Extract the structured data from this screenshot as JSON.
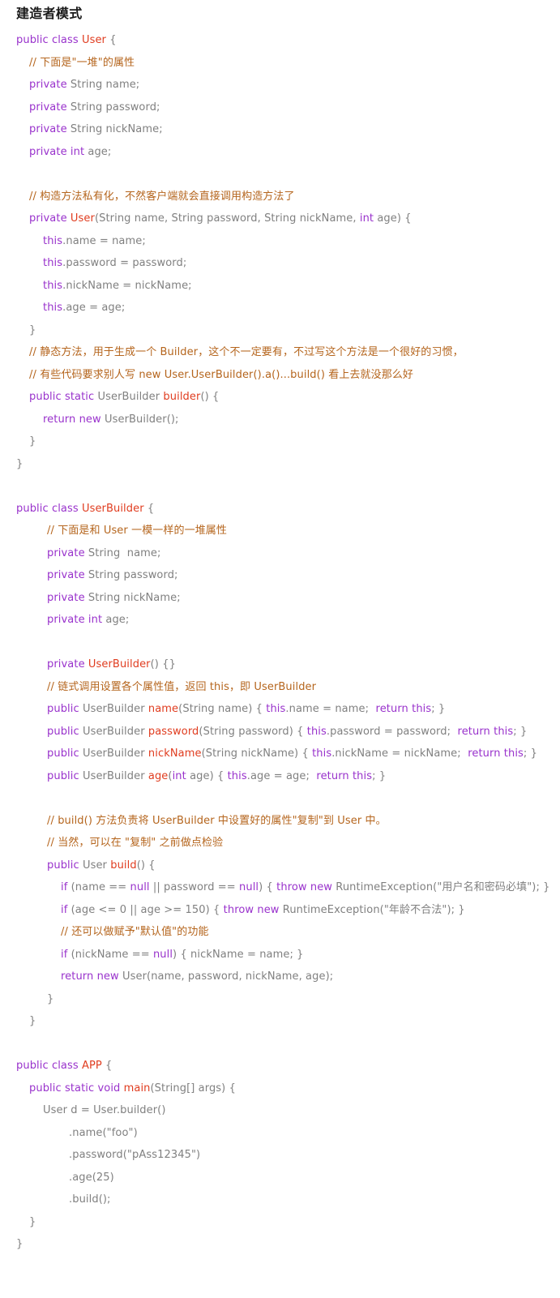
{
  "page": {
    "title": "建造者模式",
    "background_color": "#ffffff",
    "colors": {
      "keyword": "#9932cc",
      "identifier": "#e03c1f",
      "comment": "#b5651d",
      "plain": "#808080",
      "title": "#1a1a1a"
    }
  },
  "code": {
    "language": "java",
    "lines": [
      {
        "indent": 0,
        "tokens": [
          {
            "t": "public class ",
            "c": "kw"
          },
          {
            "t": "User",
            "c": "id"
          },
          {
            "t": " {",
            "c": "pl"
          }
        ]
      },
      {
        "indent": 1,
        "tokens": [
          {
            "t": "// 下面是\"一堆\"的属性",
            "c": "cm"
          }
        ]
      },
      {
        "indent": 1,
        "tokens": [
          {
            "t": "private",
            "c": "kw"
          },
          {
            "t": " String name;",
            "c": "pl"
          }
        ]
      },
      {
        "indent": 1,
        "tokens": [
          {
            "t": "private",
            "c": "kw"
          },
          {
            "t": " String password;",
            "c": "pl"
          }
        ]
      },
      {
        "indent": 1,
        "tokens": [
          {
            "t": "private",
            "c": "kw"
          },
          {
            "t": " String nickName;",
            "c": "pl"
          }
        ]
      },
      {
        "indent": 1,
        "tokens": [
          {
            "t": "private int",
            "c": "kw"
          },
          {
            "t": " age;",
            "c": "pl"
          }
        ]
      },
      {
        "indent": 0,
        "tokens": []
      },
      {
        "indent": 1,
        "tokens": [
          {
            "t": "// 构造方法私有化，不然客户端就会直接调用构造方法了",
            "c": "cm"
          }
        ]
      },
      {
        "indent": 1,
        "tokens": [
          {
            "t": "private ",
            "c": "kw"
          },
          {
            "t": "User",
            "c": "id"
          },
          {
            "t": "(String name, String password, String nickName, ",
            "c": "pl"
          },
          {
            "t": "int",
            "c": "kw"
          },
          {
            "t": " age) {",
            "c": "pl"
          }
        ]
      },
      {
        "indent": 2,
        "tokens": [
          {
            "t": "this",
            "c": "kw"
          },
          {
            "t": ".name = name;",
            "c": "pl"
          }
        ]
      },
      {
        "indent": 2,
        "tokens": [
          {
            "t": "this",
            "c": "kw"
          },
          {
            "t": ".password = password;",
            "c": "pl"
          }
        ]
      },
      {
        "indent": 2,
        "tokens": [
          {
            "t": "this",
            "c": "kw"
          },
          {
            "t": ".nickName = nickName;",
            "c": "pl"
          }
        ]
      },
      {
        "indent": 2,
        "tokens": [
          {
            "t": "this",
            "c": "kw"
          },
          {
            "t": ".age = age;",
            "c": "pl"
          }
        ]
      },
      {
        "indent": 1,
        "tokens": [
          {
            "t": "}",
            "c": "pl"
          }
        ]
      },
      {
        "indent": 1,
        "tokens": [
          {
            "t": "// 静态方法，用于生成一个 Builder，这个不一定要有，不过写这个方法是一个很好的习惯，",
            "c": "cm"
          }
        ]
      },
      {
        "indent": 1,
        "tokens": [
          {
            "t": "// 有些代码要求别人写 new User.UserBuilder().a()...build() 看上去就没那么好",
            "c": "cm"
          }
        ]
      },
      {
        "indent": 1,
        "tokens": [
          {
            "t": "public static",
            "c": "kw"
          },
          {
            "t": " UserBuilder ",
            "c": "pl"
          },
          {
            "t": "builder",
            "c": "id"
          },
          {
            "t": "() {",
            "c": "pl"
          }
        ]
      },
      {
        "indent": 2,
        "tokens": [
          {
            "t": "return new",
            "c": "kw"
          },
          {
            "t": " UserBuilder();",
            "c": "pl"
          }
        ]
      },
      {
        "indent": 1,
        "tokens": [
          {
            "t": "}",
            "c": "pl"
          }
        ]
      },
      {
        "indent": 0,
        "tokens": [
          {
            "t": "}",
            "c": "pl"
          }
        ]
      },
      {
        "indent": 0,
        "tokens": []
      },
      {
        "indent": 0,
        "tokens": [
          {
            "t": "public class ",
            "c": "kw"
          },
          {
            "t": "UserBuilder",
            "c": "id"
          },
          {
            "t": " {",
            "c": "pl"
          }
        ]
      },
      {
        "indent": 3,
        "tokens": [
          {
            "t": "// 下面是和 User 一模一样的一堆属性",
            "c": "cm"
          }
        ]
      },
      {
        "indent": 3,
        "tokens": [
          {
            "t": "private",
            "c": "kw"
          },
          {
            "t": " String  name;",
            "c": "pl"
          }
        ]
      },
      {
        "indent": 3,
        "tokens": [
          {
            "t": "private",
            "c": "kw"
          },
          {
            "t": " String password;",
            "c": "pl"
          }
        ]
      },
      {
        "indent": 3,
        "tokens": [
          {
            "t": "private",
            "c": "kw"
          },
          {
            "t": " String nickName;",
            "c": "pl"
          }
        ]
      },
      {
        "indent": 3,
        "tokens": [
          {
            "t": "private int",
            "c": "kw"
          },
          {
            "t": " age;",
            "c": "pl"
          }
        ]
      },
      {
        "indent": 0,
        "tokens": []
      },
      {
        "indent": 3,
        "tokens": [
          {
            "t": "private ",
            "c": "kw"
          },
          {
            "t": "UserBuilder",
            "c": "id"
          },
          {
            "t": "() {}",
            "c": "pl"
          }
        ]
      },
      {
        "indent": 3,
        "tokens": [
          {
            "t": "// 链式调用设置各个属性值，返回 this，即 UserBuilder",
            "c": "cm"
          }
        ]
      },
      {
        "indent": 3,
        "tokens": [
          {
            "t": "public",
            "c": "kw"
          },
          {
            "t": " UserBuilder ",
            "c": "pl"
          },
          {
            "t": "name",
            "c": "id"
          },
          {
            "t": "(String name) { ",
            "c": "pl"
          },
          {
            "t": "this",
            "c": "kw"
          },
          {
            "t": ".name = name;  ",
            "c": "pl"
          },
          {
            "t": "return this",
            "c": "kw"
          },
          {
            "t": "; }",
            "c": "pl"
          }
        ]
      },
      {
        "indent": 3,
        "tokens": [
          {
            "t": "public",
            "c": "kw"
          },
          {
            "t": " UserBuilder ",
            "c": "pl"
          },
          {
            "t": "password",
            "c": "id"
          },
          {
            "t": "(String password) { ",
            "c": "pl"
          },
          {
            "t": "this",
            "c": "kw"
          },
          {
            "t": ".password = password;  ",
            "c": "pl"
          },
          {
            "t": "return this",
            "c": "kw"
          },
          {
            "t": "; }",
            "c": "pl"
          }
        ]
      },
      {
        "indent": 3,
        "tokens": [
          {
            "t": "public",
            "c": "kw"
          },
          {
            "t": " UserBuilder ",
            "c": "pl"
          },
          {
            "t": "nickName",
            "c": "id"
          },
          {
            "t": "(String nickName) { ",
            "c": "pl"
          },
          {
            "t": "this",
            "c": "kw"
          },
          {
            "t": ".nickName = nickName;  ",
            "c": "pl"
          },
          {
            "t": "return this",
            "c": "kw"
          },
          {
            "t": "; }",
            "c": "pl"
          }
        ]
      },
      {
        "indent": 3,
        "tokens": [
          {
            "t": "public",
            "c": "kw"
          },
          {
            "t": " UserBuilder ",
            "c": "pl"
          },
          {
            "t": "age",
            "c": "id"
          },
          {
            "t": "(",
            "c": "pl"
          },
          {
            "t": "int",
            "c": "kw"
          },
          {
            "t": " age) { ",
            "c": "pl"
          },
          {
            "t": "this",
            "c": "kw"
          },
          {
            "t": ".age = age;  ",
            "c": "pl"
          },
          {
            "t": "return this",
            "c": "kw"
          },
          {
            "t": "; }",
            "c": "pl"
          }
        ]
      },
      {
        "indent": 0,
        "tokens": []
      },
      {
        "indent": 3,
        "tokens": [
          {
            "t": "// build() 方法负责将 UserBuilder 中设置好的属性\"复制\"到 User 中。",
            "c": "cm"
          }
        ]
      },
      {
        "indent": 3,
        "tokens": [
          {
            "t": "// 当然，可以在 \"复制\" 之前做点检验",
            "c": "cm"
          }
        ]
      },
      {
        "indent": 3,
        "tokens": [
          {
            "t": "public",
            "c": "kw"
          },
          {
            "t": " User ",
            "c": "pl"
          },
          {
            "t": "build",
            "c": "id"
          },
          {
            "t": "() {",
            "c": "pl"
          }
        ]
      },
      {
        "indent": 4,
        "tokens": [
          {
            "t": "if",
            "c": "kw"
          },
          {
            "t": " (name == ",
            "c": "pl"
          },
          {
            "t": "null",
            "c": "kw"
          },
          {
            "t": " || password == ",
            "c": "pl"
          },
          {
            "t": "null",
            "c": "kw"
          },
          {
            "t": ") { ",
            "c": "pl"
          },
          {
            "t": "throw new",
            "c": "kw"
          },
          {
            "t": " RuntimeException(\"用户名和密码必填\"); }",
            "c": "pl"
          }
        ]
      },
      {
        "indent": 4,
        "tokens": [
          {
            "t": "if",
            "c": "kw"
          },
          {
            "t": " (age <= 0 || age >= 150) { ",
            "c": "pl"
          },
          {
            "t": "throw new",
            "c": "kw"
          },
          {
            "t": " RuntimeException(\"年龄不合法\"); }",
            "c": "pl"
          }
        ]
      },
      {
        "indent": 4,
        "tokens": [
          {
            "t": "// 还可以做赋予\"默认值\"的功能",
            "c": "cm"
          }
        ]
      },
      {
        "indent": 4,
        "tokens": [
          {
            "t": "if",
            "c": "kw"
          },
          {
            "t": " (nickName == ",
            "c": "pl"
          },
          {
            "t": "null",
            "c": "kw"
          },
          {
            "t": ") { nickName = name; }",
            "c": "pl"
          }
        ]
      },
      {
        "indent": 4,
        "tokens": [
          {
            "t": "return new",
            "c": "kw"
          },
          {
            "t": " User(name, password, nickName, age);",
            "c": "pl"
          }
        ]
      },
      {
        "indent": 3,
        "tokens": [
          {
            "t": "}",
            "c": "pl"
          }
        ]
      },
      {
        "indent": 1,
        "tokens": [
          {
            "t": "}",
            "c": "pl"
          }
        ]
      },
      {
        "indent": 0,
        "tokens": []
      },
      {
        "indent": 0,
        "tokens": [
          {
            "t": "public class ",
            "c": "kw"
          },
          {
            "t": "APP",
            "c": "id"
          },
          {
            "t": " {",
            "c": "pl"
          }
        ]
      },
      {
        "indent": 1,
        "tokens": [
          {
            "t": "public static void ",
            "c": "kw"
          },
          {
            "t": "main",
            "c": "id"
          },
          {
            "t": "(String[] args) {",
            "c": "pl"
          }
        ]
      },
      {
        "indent": 2,
        "tokens": [
          {
            "t": "User d = User.builder()",
            "c": "pl"
          }
        ]
      },
      {
        "indent": 5,
        "tokens": [
          {
            "t": ".name(\"foo\")",
            "c": "pl"
          }
        ]
      },
      {
        "indent": 5,
        "tokens": [
          {
            "t": ".password(\"pAss12345\")",
            "c": "pl"
          }
        ]
      },
      {
        "indent": 5,
        "tokens": [
          {
            "t": ".age(25)",
            "c": "pl"
          }
        ]
      },
      {
        "indent": 5,
        "tokens": [
          {
            "t": ".build();",
            "c": "pl"
          }
        ]
      },
      {
        "indent": 1,
        "tokens": [
          {
            "t": "}",
            "c": "pl"
          }
        ]
      },
      {
        "indent": 0,
        "tokens": [
          {
            "t": "}",
            "c": "pl"
          }
        ]
      }
    ]
  }
}
